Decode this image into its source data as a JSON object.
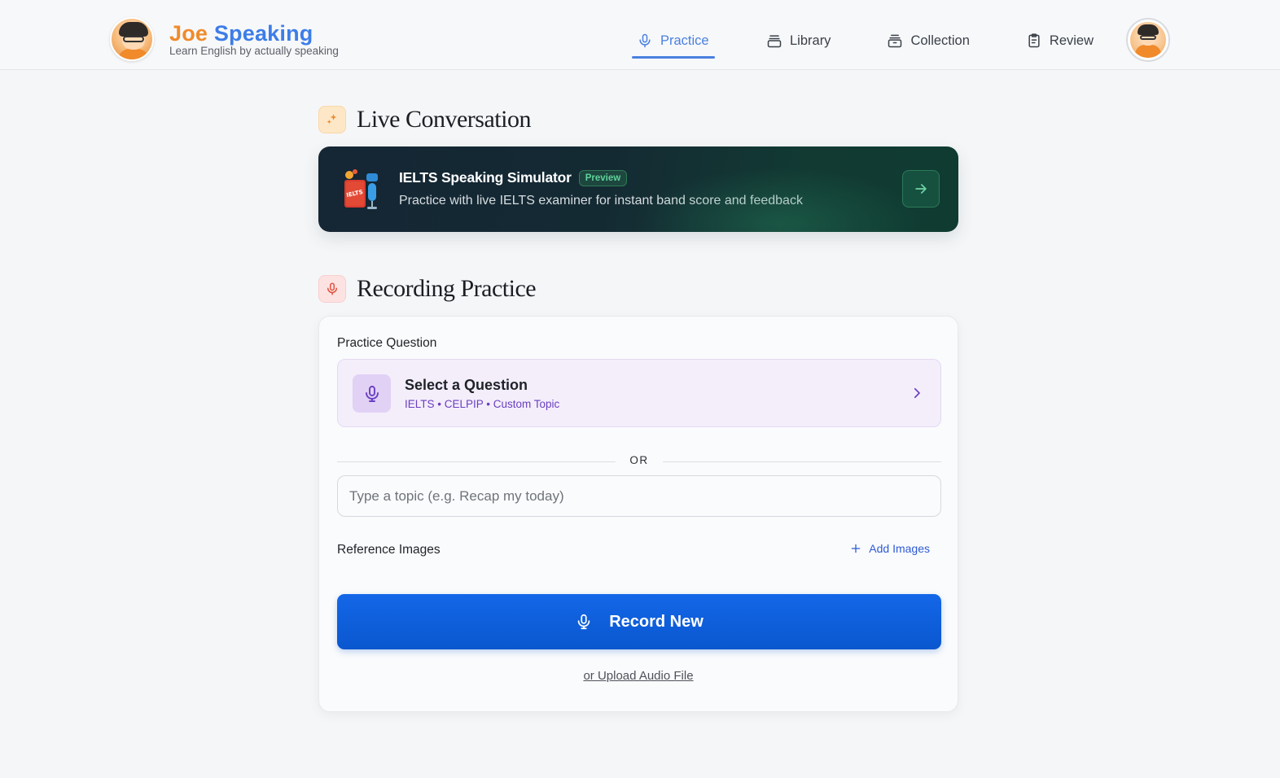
{
  "header": {
    "brand_first": "Joe",
    "brand_second": "Speaking",
    "tagline": "Learn English by actually speaking",
    "nav": [
      {
        "label": "Practice",
        "icon": "microphone-icon",
        "active": true
      },
      {
        "label": "Library",
        "icon": "folder-icon",
        "active": false
      },
      {
        "label": "Collection",
        "icon": "archive-icon",
        "active": false
      },
      {
        "label": "Review",
        "icon": "clipboard-icon",
        "active": false
      }
    ]
  },
  "live_conversation": {
    "title": "Live Conversation",
    "icon": "sparkle-icon",
    "simulator": {
      "title": "IELTS Speaking Simulator",
      "badge": "Preview",
      "description": "Practice with live IELTS examiner for instant band score and feedback",
      "illustration_text": "IELTS"
    }
  },
  "recording_practice": {
    "title": "Recording Practice",
    "icon": "microphone-icon",
    "question_label": "Practice Question",
    "question_picker": {
      "title": "Select a Question",
      "subtitle": "IELTS • CELPIP • Custom Topic"
    },
    "or_divider": "OR",
    "topic_input": {
      "value": "",
      "placeholder": "Type a topic (e.g. Recap my today)"
    },
    "reference_images_label": "Reference Images",
    "add_images_label": "Add Images",
    "record_button_label": "Record New",
    "upload_link_label": "or Upload Audio File"
  },
  "colors": {
    "brand_orange": "#f08a2b",
    "brand_blue": "#3d7de8",
    "nav_active": "#4a80e0",
    "primary_button": "#0a5fdc",
    "question_accent": "#6a3fc0",
    "badge_green": "#5fd39b"
  }
}
